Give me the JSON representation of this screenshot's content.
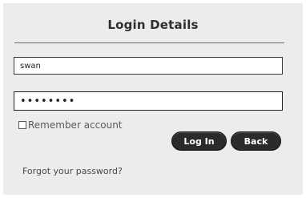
{
  "dialog": {
    "title": "Login Details"
  },
  "form": {
    "username_value": "swan",
    "password_value": "password",
    "remember_label": "Remember account",
    "remember_checked": false
  },
  "buttons": {
    "login_label": "Log In",
    "back_label": "Back"
  },
  "links": {
    "forgot_label": "Forgot your password?"
  },
  "colors": {
    "panel_bg": "#ececec",
    "button_bg": "#2b2b2b",
    "button_text": "#ffffff"
  }
}
